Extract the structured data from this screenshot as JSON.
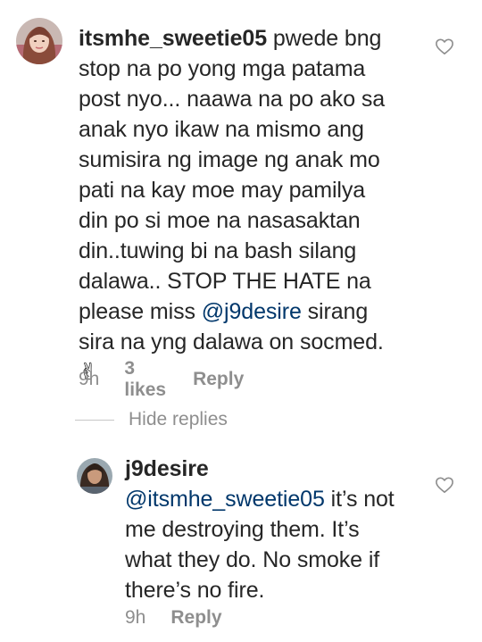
{
  "comment": {
    "username": "itsmhe_sweetie05",
    "text_lines": [
      " pwede bng",
      "stop na po yong mga patama",
      "post  nyo... naawa na po ako sa",
      "anak nyo ikaw na mismo ang",
      "sumisira ng image ng anak mo",
      "pati na kay moe may pamilya",
      "din po si moe  na nasasaktan",
      "din..tuwing bi na bash silang",
      "dalawa.. STOP THE HATE na"
    ],
    "line10_prefix": "please miss ",
    "mention": "@j9desire",
    "line10_suffix": " sirang",
    "line11": "sira na yng dalawa on socmed.",
    "emoji": "✌",
    "time": "9h",
    "likes": "3 likes",
    "reply_label": "Reply",
    "avatar_icon": "user-avatar",
    "like_icon": "heart-outline-icon"
  },
  "hide_replies_label": "Hide replies",
  "reply": {
    "username": "j9desire",
    "mention": "@itsmhe_sweetie05",
    "line1_suffix": " it’s not",
    "text_lines": [
      "me destroying them. It’s",
      "what they do. No smoke if",
      "there’s no fire."
    ],
    "time": "9h",
    "reply_label": "Reply",
    "avatar_icon": "user-avatar",
    "like_icon": "heart-outline-icon"
  },
  "colors": {
    "text": "#262626",
    "secondary": "#8e8e8e",
    "mention": "#00376b",
    "background": "#ffffff"
  }
}
